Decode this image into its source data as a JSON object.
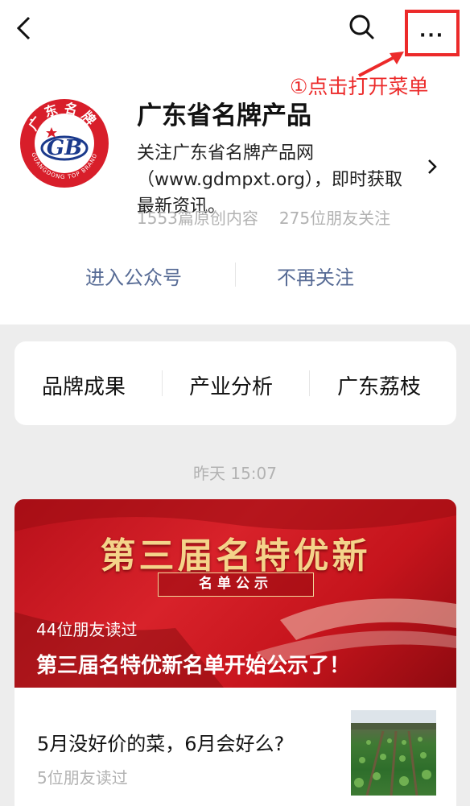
{
  "nav": {
    "back_icon": "chevron-left-icon",
    "search_icon": "search-icon",
    "more_icon": "more-dots-icon",
    "more_glyph": "···"
  },
  "annotation": {
    "text": "①点击打开菜单",
    "color": "#ec2a2a"
  },
  "account": {
    "name": "广东省名牌产品",
    "description": "关注广东省名牌产品网（www.gdmpxt.org），即时获取最新资讯。",
    "articles": "1553篇原创内容",
    "followers": "275位朋友关注",
    "logo": {
      "arc_text": "广东名牌",
      "emblem_text": "GB",
      "bottom_text": "GUANGDONG TOP BRAND"
    }
  },
  "actions": {
    "enter": "进入公众号",
    "unfollow": "不再关注"
  },
  "menu": {
    "items": [
      {
        "label": "品牌成果"
      },
      {
        "label": "产业分析"
      },
      {
        "label": "广东荔枝"
      }
    ]
  },
  "feed": {
    "timestamp": "昨天 15:07",
    "featured": {
      "banner_title": "第三届名特优新",
      "banner_subtitle": "名单公示",
      "readers": "44位朋友读过",
      "headline": "第三届名特优新名单开始公示了！"
    },
    "article2": {
      "title": "5月没好价的菜，6月会好么?",
      "readers": "5位朋友读过"
    }
  },
  "colors": {
    "link": "#576b95",
    "muted": "#b2b2b2",
    "background": "#ededed",
    "banner_red": "#d8222a"
  }
}
